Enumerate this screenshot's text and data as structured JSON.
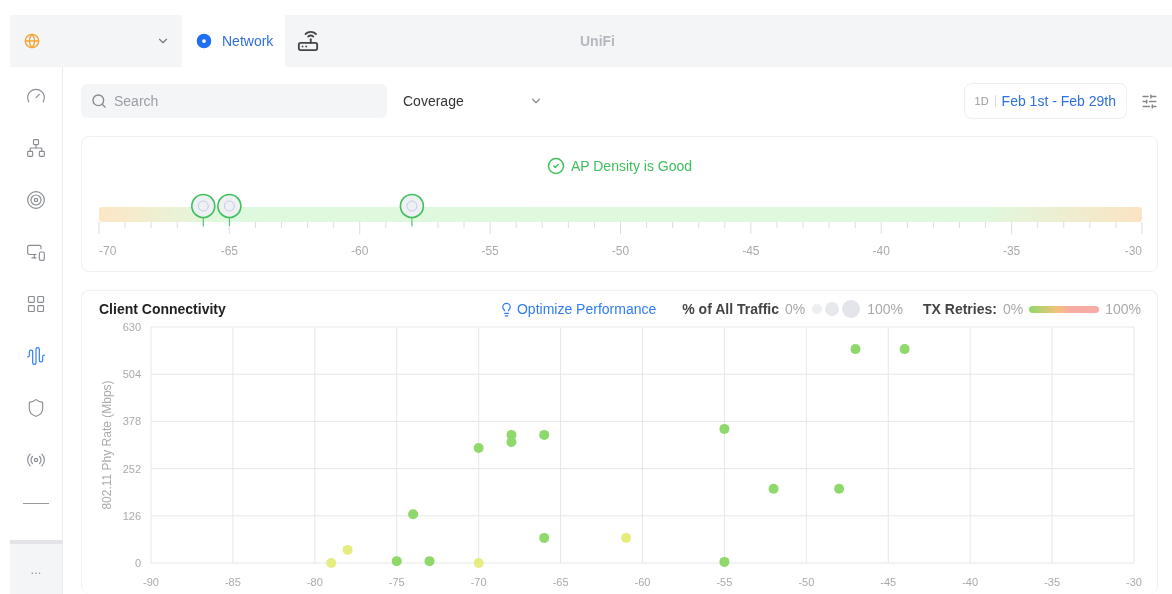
{
  "top_bar": {
    "title": "UniFi",
    "tabs": [
      {
        "kind": "site",
        "selected": false
      },
      {
        "kind": "network",
        "label": "Network",
        "selected": true
      },
      {
        "kind": "devices",
        "selected": false
      }
    ]
  },
  "sidebar": {
    "items": [
      {
        "kind": "dashboard",
        "selected": false
      },
      {
        "kind": "topology",
        "selected": false
      },
      {
        "kind": "target",
        "selected": false
      },
      {
        "kind": "devices",
        "selected": false
      },
      {
        "kind": "clients",
        "selected": false
      },
      {
        "kind": "radio",
        "selected": true
      },
      {
        "kind": "security",
        "selected": false
      },
      {
        "kind": "broadcast",
        "selected": false
      }
    ],
    "more": "..."
  },
  "toolbar": {
    "search": {
      "placeholder": "Search"
    },
    "view": {
      "value": "Coverage"
    },
    "range": {
      "period": "1D",
      "dates": "Feb 1st - Feb 29th"
    }
  },
  "density": {
    "status": "AP Density is Good",
    "axis_labels": [
      "-70",
      "-65",
      "-60",
      "-55",
      "-50",
      "-45",
      "-40",
      "-35",
      "-30"
    ],
    "access_points": [
      {
        "level": 0.1
      },
      {
        "level": 0.125
      },
      {
        "level": 0.3
      }
    ]
  },
  "connectivity": {
    "title": "Client Connectivity",
    "action": "Optimize Performance",
    "traffic_legend": {
      "label": "% of All Traffic",
      "min": "0%",
      "max": "100%"
    },
    "retries_legend": {
      "label": "TX Retries:",
      "min": "0%",
      "max": "100%"
    },
    "chart_data": {
      "type": "scatter",
      "grid": true,
      "ylabel": "802.11 Phy Rate (Mbps)",
      "xlim": [
        -90,
        -30
      ],
      "ylim": [
        0,
        630
      ],
      "xticks": [
        {
          "value": -90,
          "label": "-90"
        },
        {
          "value": -85,
          "label": "-85"
        },
        {
          "value": -80,
          "label": "-80"
        },
        {
          "value": -75,
          "label": "-75"
        },
        {
          "value": -70,
          "label": "-70"
        },
        {
          "value": -65,
          "label": "-65"
        },
        {
          "value": -60,
          "label": "-60"
        },
        {
          "value": -55,
          "label": "-55"
        },
        {
          "value": -50,
          "label": "-50"
        },
        {
          "value": -45,
          "label": "-45"
        },
        {
          "value": -40,
          "label": "-40"
        },
        {
          "value": -35,
          "label": "-35"
        },
        {
          "value": -30,
          "label": "-30"
        }
      ],
      "yticks": [
        0,
        126,
        252,
        378,
        504,
        630
      ],
      "series": [
        {
          "color": "#8ed86c",
          "x": [
            -75,
            -74,
            -73,
            -70,
            -68,
            -68,
            -66,
            -66,
            -55,
            -55,
            -52,
            -48,
            -47,
            -44
          ],
          "values": [
            5,
            130,
            5,
            307,
            342,
            323,
            342,
            67,
            358,
            3,
            198,
            198,
            571,
            571
          ]
        },
        {
          "color": "#e6ed80",
          "x": [
            -79,
            -78,
            -70,
            -61
          ],
          "values": [
            0,
            35,
            0,
            67
          ]
        }
      ]
    }
  }
}
